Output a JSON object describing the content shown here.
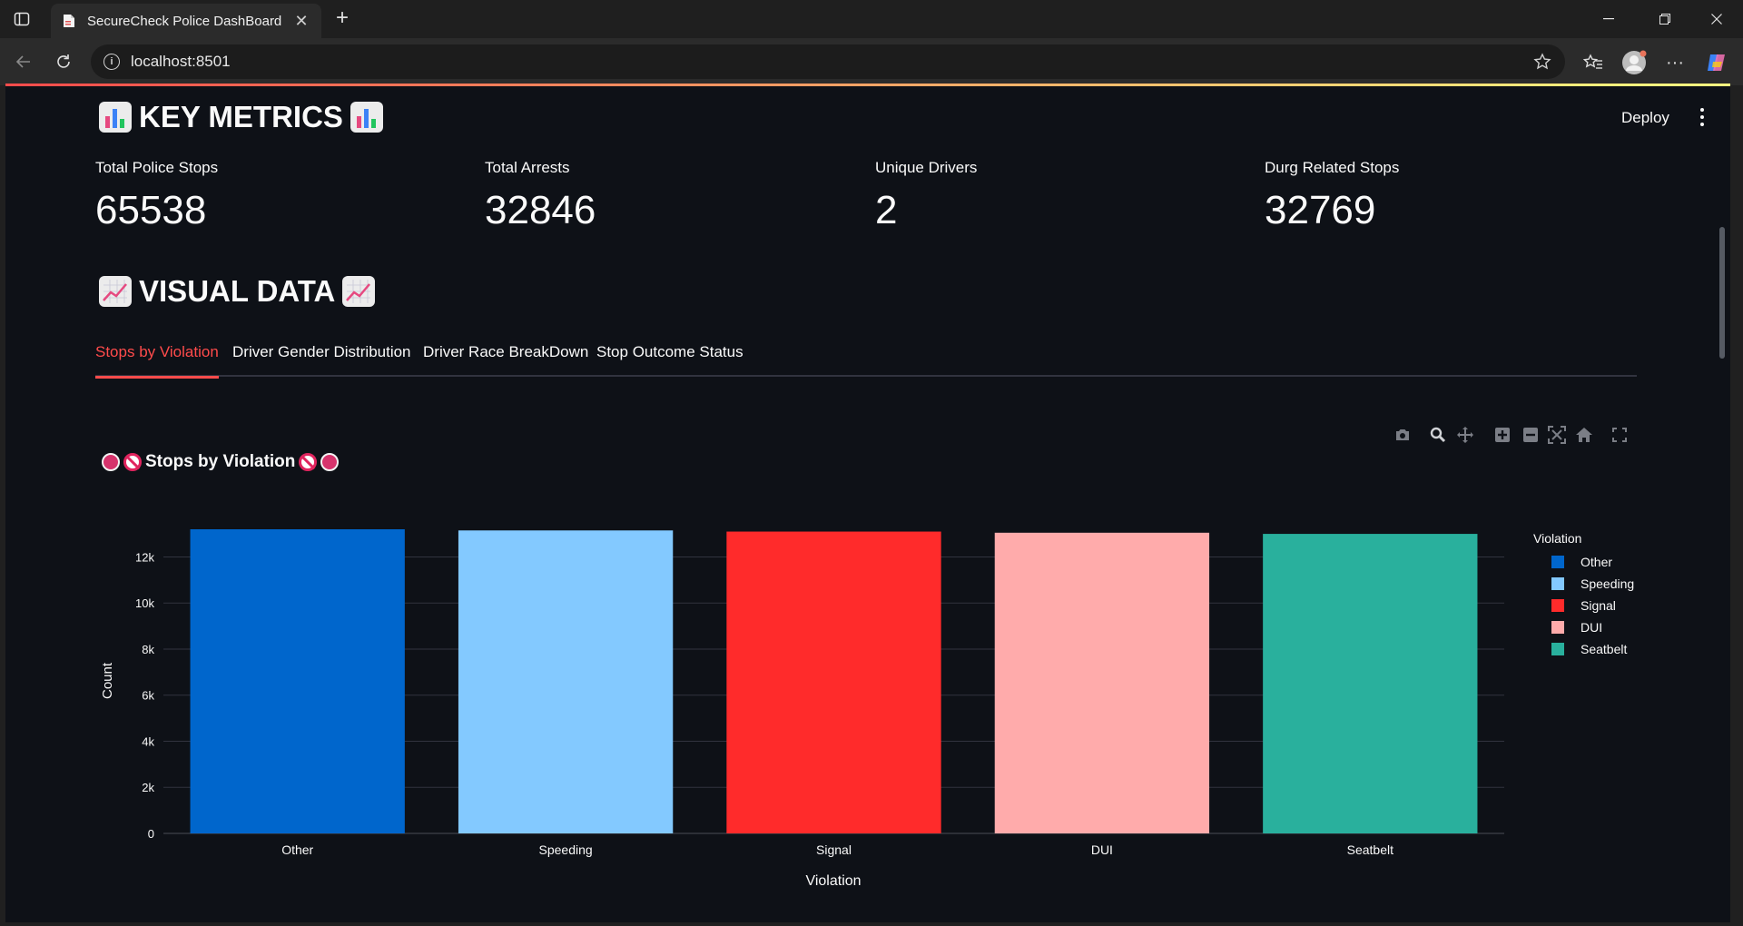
{
  "browser": {
    "tab_title": "SecureCheck Police DashBoard",
    "url": "localhost:8501"
  },
  "app": {
    "deploy_label": "Deploy",
    "key_metrics_title": "KEY METRICS",
    "visual_data_title": "VISUAL DATA",
    "metrics": [
      {
        "label": "Total Police Stops",
        "value": "65538"
      },
      {
        "label": "Total Arrests",
        "value": "32846"
      },
      {
        "label": "Unique Drivers",
        "value": "2"
      },
      {
        "label": "Durg Related Stops",
        "value": "32769"
      }
    ],
    "tabs": [
      {
        "label": "Stops by Violation"
      },
      {
        "label": "Driver Gender Distribution"
      },
      {
        "label": "Driver Race BreakDown"
      },
      {
        "label": "Stop Outcome Status"
      }
    ],
    "active_tab": 0
  },
  "chart_data": {
    "type": "bar",
    "title": "Stops by Violation",
    "xlabel": "Violation",
    "ylabel": "Count",
    "categories": [
      "Other",
      "Speeding",
      "Signal",
      "DUI",
      "Seatbelt"
    ],
    "values": [
      13200,
      13150,
      13100,
      13050,
      13000
    ],
    "colors": [
      "#0066cc",
      "#83c9ff",
      "#ff2b2b",
      "#ffabab",
      "#29b09d"
    ],
    "ylim": [
      0,
      13200
    ],
    "yticks": [
      0,
      2000,
      4000,
      6000,
      8000,
      10000,
      12000
    ],
    "yticklabels": [
      "0",
      "2k",
      "4k",
      "6k",
      "8k",
      "10k",
      "12k"
    ],
    "legend": {
      "title": "Violation",
      "position": "right",
      "items": [
        "Other",
        "Speeding",
        "Signal",
        "DUI",
        "Seatbelt"
      ]
    },
    "grid": true
  }
}
